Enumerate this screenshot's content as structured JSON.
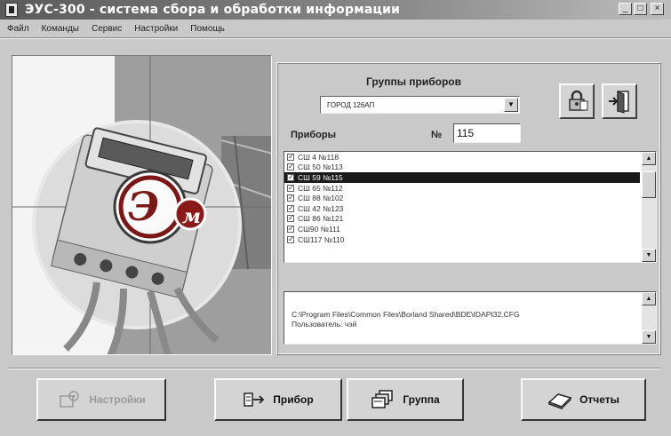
{
  "window": {
    "title": "ЭУС-300 - система сбора и обработки информации",
    "min_label": "_",
    "max_label": "□",
    "close_label": "×"
  },
  "menu": [
    {
      "label": "Файл"
    },
    {
      "label": "Команды"
    },
    {
      "label": "Сервис"
    },
    {
      "label": "Настройки"
    },
    {
      "label": "Помощь"
    }
  ],
  "logo": {
    "letters": "ЭМ"
  },
  "groups": {
    "label": "Группы приборов",
    "selected": "ГОРОД 126АП"
  },
  "devices": {
    "label": "Приборы",
    "num_label": "№",
    "num_value": "115",
    "items": [
      {
        "label": "СШ 4 №118",
        "checked": true,
        "selected": false
      },
      {
        "label": "СШ 50 №113",
        "checked": true,
        "selected": false
      },
      {
        "label": "СШ 59 №115",
        "checked": true,
        "selected": true
      },
      {
        "label": "СШ 65 №112",
        "checked": true,
        "selected": false
      },
      {
        "label": "СШ 88 №102",
        "checked": true,
        "selected": false
      },
      {
        "label": "СШ 42 №123",
        "checked": true,
        "selected": false
      },
      {
        "label": "СШ 86 №121",
        "checked": true,
        "selected": false
      },
      {
        "label": "СШ90 №111",
        "checked": true,
        "selected": false
      },
      {
        "label": "СШ117 №110",
        "checked": true,
        "selected": false
      }
    ]
  },
  "log": {
    "lines": [
      "C:\\Program Files\\Common Files\\Borland Shared\\BDE\\IDAPI32.CFG",
      "Пользователь: чэй"
    ]
  },
  "buttons": {
    "settings": "Настройки",
    "device": "Прибор",
    "group": "Группа",
    "reports": "Отчеты"
  },
  "colors": {
    "face": "#c9c9c9",
    "button_face": "#d4d4d4",
    "selection": "#1a1a1a",
    "logo_red": "#9b1c1c"
  }
}
